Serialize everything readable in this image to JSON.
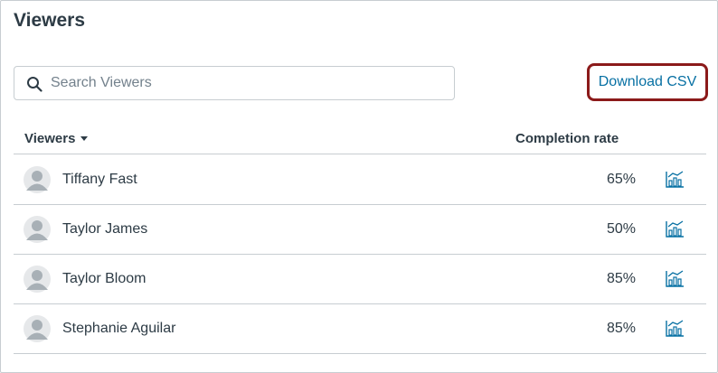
{
  "page": {
    "title": "Viewers"
  },
  "search": {
    "placeholder": "Search Viewers",
    "value": ""
  },
  "toolbar": {
    "download_label": "Download CSV"
  },
  "table": {
    "columns": {
      "viewers": "Viewers",
      "completion_rate": "Completion rate"
    },
    "sort_icon": "caret-down-icon",
    "rows": [
      {
        "name": "Tiffany Fast",
        "completion_rate": "65%"
      },
      {
        "name": "Taylor James",
        "completion_rate": "50%"
      },
      {
        "name": "Taylor Bloom",
        "completion_rate": "85%"
      },
      {
        "name": "Stephanie Aguilar",
        "completion_rate": "85%"
      }
    ]
  },
  "icons": {
    "avatar": "avatar-icon",
    "analytics": "bar-chart-icon",
    "search": "search-icon"
  },
  "colors": {
    "link": "#0770a3",
    "highlight_border": "#8b1a1a",
    "text": "#2d3b45",
    "border": "#c7cdd1"
  }
}
